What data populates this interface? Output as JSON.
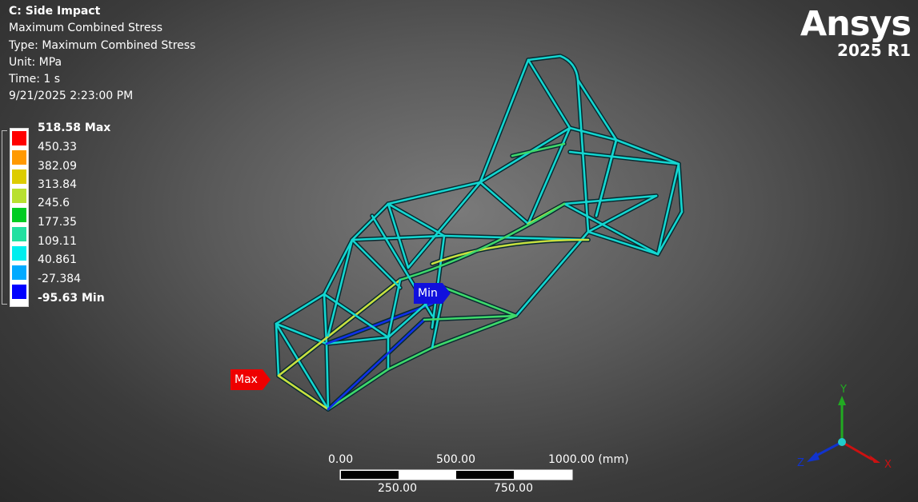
{
  "info": {
    "title": "C: Side Impact",
    "result": "Maximum Combined Stress",
    "type": "Type: Maximum Combined Stress",
    "unit": "Unit: MPa",
    "time": "Time: 1 s",
    "date": "9/21/2025 2:23:00 PM"
  },
  "legend": {
    "max_label": "518.58 Max",
    "levels": [
      "450.33",
      "382.09",
      "313.84",
      "245.6",
      "177.35",
      "109.11",
      "40.861",
      "-27.384"
    ],
    "min_label": "-95.63 Min",
    "colors": [
      "#ff0000",
      "#ff9900",
      "#ddcc00",
      "#b8e030",
      "#00cc22",
      "#22e0a0",
      "#00eeee",
      "#00aaff",
      "#0000ff"
    ]
  },
  "logo": {
    "brand": "Ansys",
    "version": "2025 R1"
  },
  "probes": {
    "max": "Max",
    "min": "Min",
    "max_color": "#ee0000",
    "min_color": "#1010dd"
  },
  "scale_bar": {
    "top_labels": [
      "0.00",
      "500.00",
      "1000.00 (mm)"
    ],
    "bottom_labels": [
      "250.00",
      "750.00"
    ]
  },
  "triad": {
    "x": "X",
    "y": "Y",
    "z": "Z",
    "x_color": "#cc1111",
    "y_color": "#22aa22",
    "z_color": "#1133cc"
  }
}
